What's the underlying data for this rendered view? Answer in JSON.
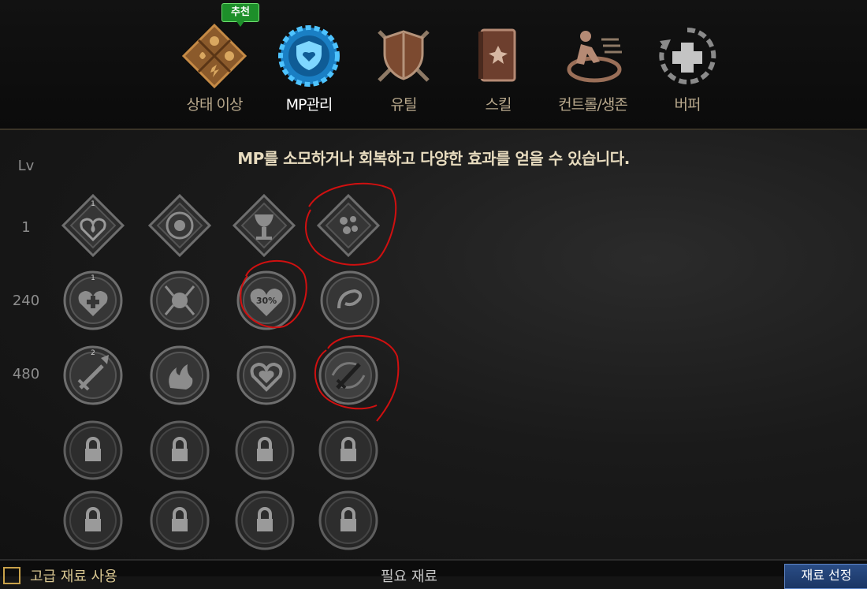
{
  "tabs": [
    {
      "label": "상태 이상",
      "icon": "status-ailment-icon"
    },
    {
      "label": "MP관리",
      "icon": "mp-shield-icon",
      "active": true
    },
    {
      "label": "유틸",
      "icon": "utility-shield-icon"
    },
    {
      "label": "스킬",
      "icon": "skill-book-icon"
    },
    {
      "label": "컨트롤/생존",
      "icon": "control-survival-icon"
    },
    {
      "label": "버퍼",
      "icon": "buffer-cross-icon"
    }
  ],
  "recommend_badge": "추천",
  "description": "MP를 소모하거나 회복하고 다양한 효과를 얻을 수 있습니다.",
  "level_header": "Lv",
  "levels": [
    "1",
    "240",
    "480"
  ],
  "skills": {
    "row1": [
      {
        "icon": "heart-drop-icon",
        "rank": "1"
      },
      {
        "icon": "orb-diamond-icon"
      },
      {
        "icon": "chalice-diamond-icon"
      },
      {
        "icon": "crystals-diamond-icon",
        "circled": true
      }
    ],
    "row2": [
      {
        "icon": "heart-plus-icon",
        "rank": "1"
      },
      {
        "icon": "lightning-orb-icon"
      },
      {
        "icon": "heart-percent-icon",
        "text": "30%",
        "circled": true
      },
      {
        "icon": "swirl-icon"
      }
    ],
    "row3": [
      {
        "icon": "sword-up-icon",
        "rank": "2"
      },
      {
        "icon": "flame-beast-icon"
      },
      {
        "icon": "double-heart-icon"
      },
      {
        "icon": "sword-vortex-icon",
        "circled": true
      }
    ]
  },
  "locked_icon": "lock-icon",
  "bottom": {
    "checkbox_label": "고급 재료 사용",
    "need_label": "필요 재료",
    "reset_button": "재료 선정"
  },
  "colors": {
    "accent": "#e8dcbf",
    "tab_label": "#b7a78b",
    "recommend": "#1d8f2a",
    "annotation": "#d01010"
  }
}
